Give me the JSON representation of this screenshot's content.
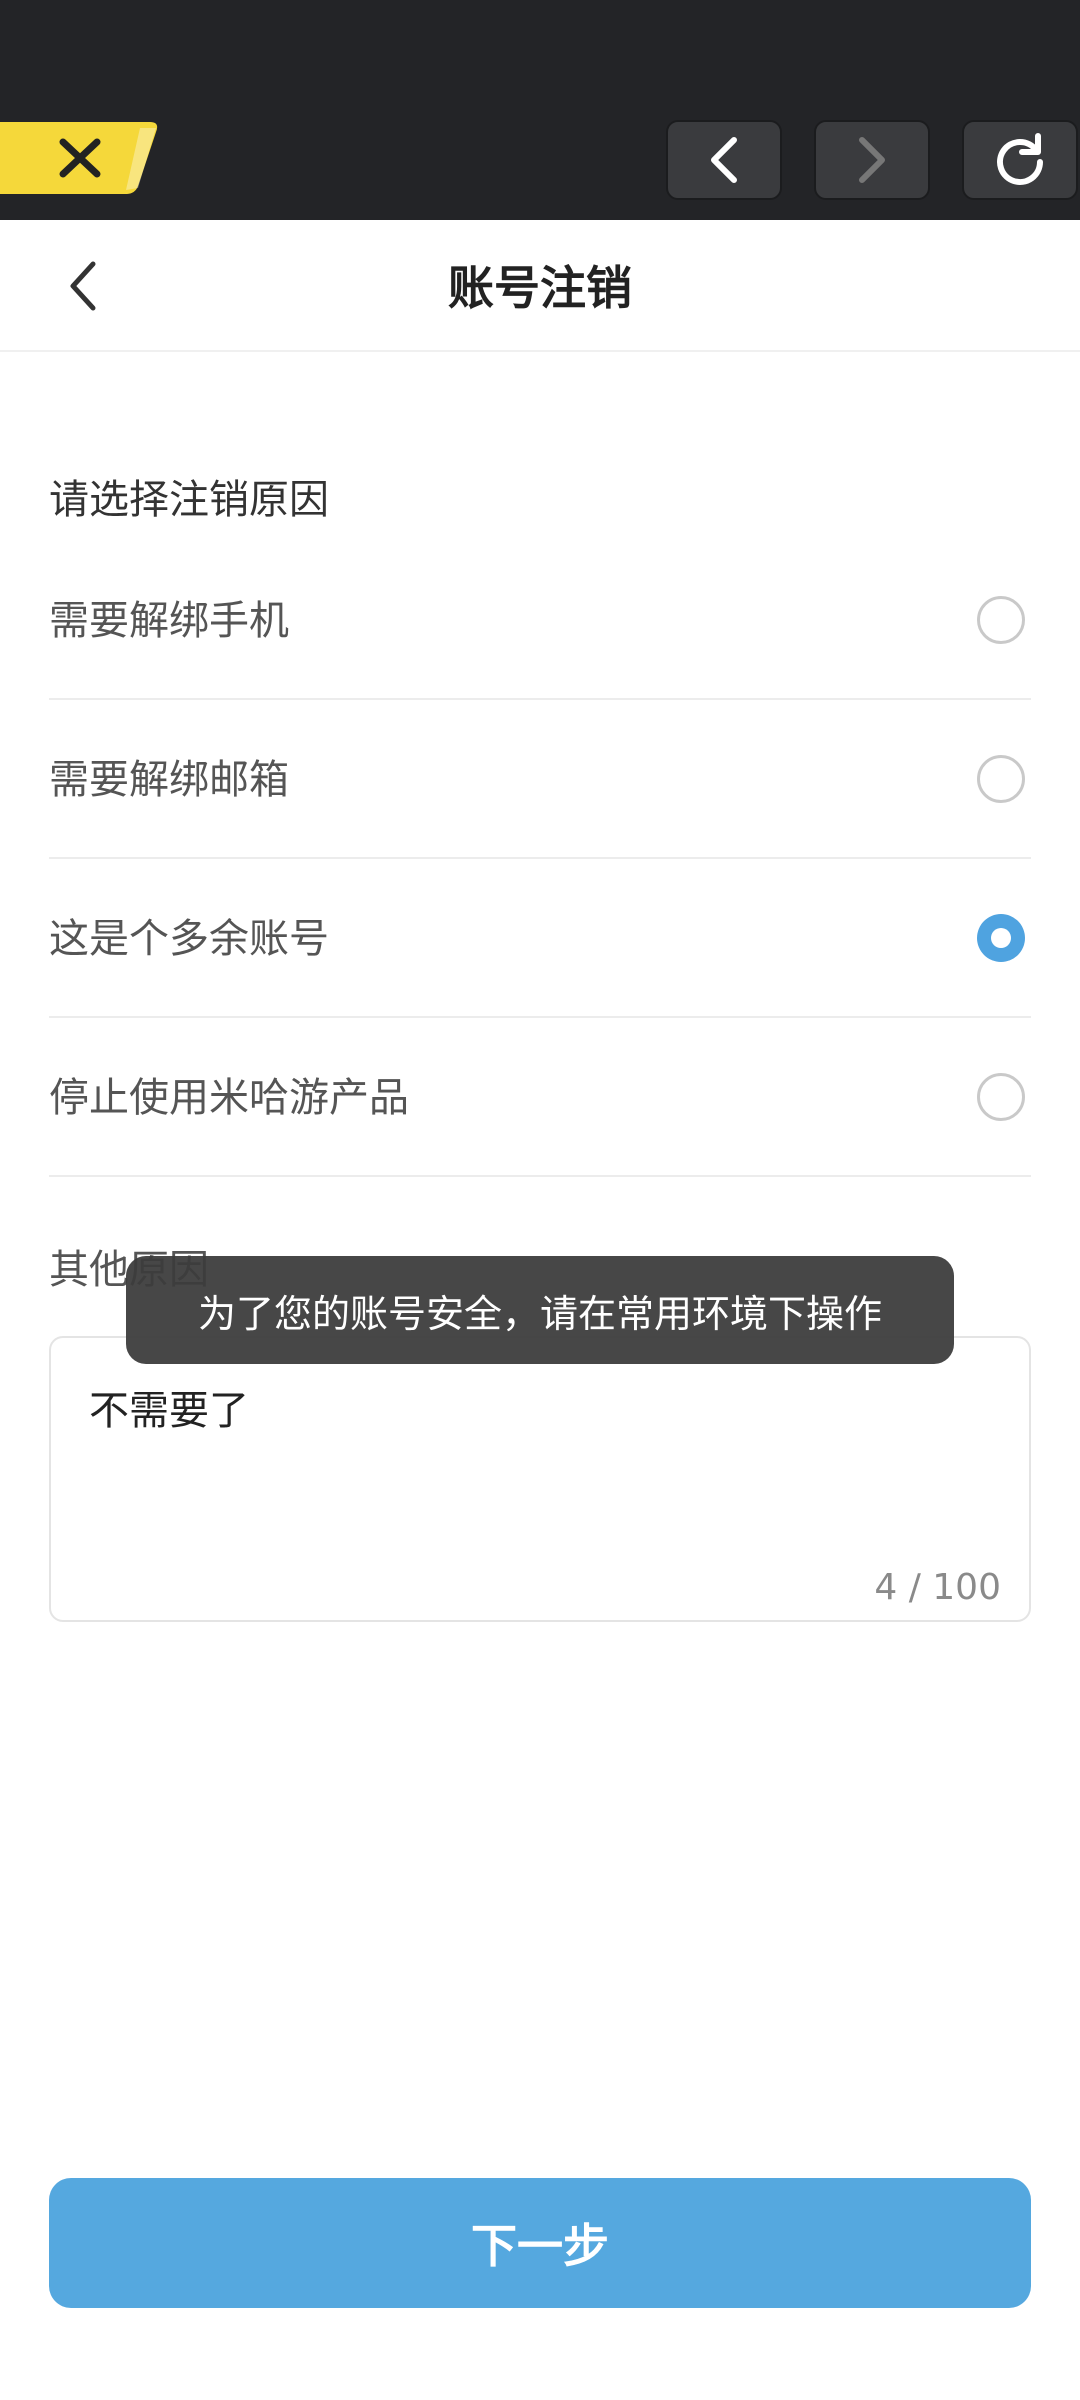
{
  "browser_toolbar": {
    "close_icon": "close-icon",
    "back_icon": "chevron-left-icon",
    "forward_icon": "chevron-right-icon",
    "refresh_icon": "refresh-icon",
    "close_tab_color": "#f5d83a"
  },
  "header": {
    "back_icon": "chevron-left-icon",
    "title": "账号注销"
  },
  "form": {
    "prompt": "请选择注销原因",
    "options": [
      {
        "label": "需要解绑手机",
        "selected": false
      },
      {
        "label": "需要解绑邮箱",
        "selected": false
      },
      {
        "label": "这是个多余账号",
        "selected": true
      },
      {
        "label": "停止使用米哈游产品",
        "selected": false
      }
    ],
    "other_label": "其他原因",
    "other_value": "不需要了",
    "char_count": "4 / 100"
  },
  "toast": {
    "message": "为了您的账号安全，请在常用环境下操作"
  },
  "footer": {
    "next_label": "下一步"
  },
  "colors": {
    "accent": "#4fa3e0",
    "button": "#55a8df",
    "topbar": "#232427"
  }
}
